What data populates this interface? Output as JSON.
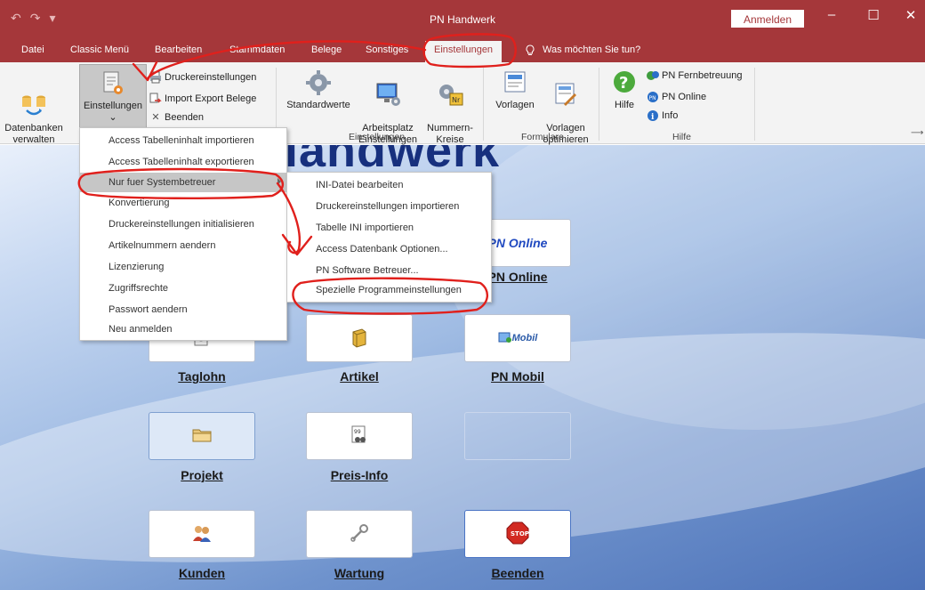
{
  "window": {
    "title": "PN Handwerk",
    "signin_label": "Anmelden",
    "controls": {
      "minimize": "–",
      "maximize": "☐",
      "close": "✕"
    },
    "qat": {
      "undo": "↶",
      "redo": "↷",
      "customize": "▾"
    }
  },
  "tabs": [
    "Datei",
    "Classic Menü",
    "Bearbeiten",
    "Stammdaten",
    "Belege",
    "Sonstiges",
    "Einstellungen"
  ],
  "active_tab": "Einstellungen",
  "tell_me": {
    "icon": "lightbulb-icon",
    "label": "Was möchten Sie tun?"
  },
  "ribbon": {
    "datenbanken": "Datenbanken\nverwalten",
    "einstellungen": "Einstellungen",
    "einstellungen_caret": "⌄",
    "druckereinstellungen": "Druckereinstellungen",
    "import_export": "Import Export Belege",
    "beenden": "Beenden",
    "standardwerte": "Standardwerte",
    "arbeitsplatz": "Arbeitsplatz\nEinstellungen",
    "nummernkreise": "Nummern-\nKreise",
    "vorlagen": "Vorlagen",
    "vorlagen_opt": "Vorlagen\noptimieren",
    "hilfe": "Hilfe",
    "fernbetreuung": "PN Fernbetreuung",
    "pn_online": "PN Online",
    "info": "Info",
    "group_einstellungen": "Einstellungen",
    "group_formulare": "Formulare",
    "group_hilfe": "Hilfe"
  },
  "menu_main": [
    "Access Tabelleninhalt importieren",
    "Access Tabelleninhalt exportieren",
    "Nur fuer Systembetreuer",
    "Konvertierung",
    "Druckereinstellungen initialisieren",
    "Artikelnummern aendern",
    "Lizenzierung",
    "Zugriffsrechte",
    "Passwort aendern",
    "Neu anmelden"
  ],
  "menu_sub": [
    "INI-Datei bearbeiten",
    "Druckereinstellungen importieren",
    "Tabelle INI importieren",
    "Access Datenbank Optionen...",
    "PN Software Betreuer...",
    "Spezielle Programmeinstellungen"
  ],
  "main": {
    "banner": "landwerk",
    "pn_online_tile": "PN Online",
    "pn_mobil_tile": "Mobil",
    "tiles": {
      "pn_online": "PN Online",
      "taglohn": "Taglohn",
      "artikel": "Artikel",
      "pn_mobil": "PN Mobil",
      "projekt": "Projekt",
      "preis_info": "Preis-Info",
      "kunden": "Kunden",
      "wartung": "Wartung",
      "beenden": "Beenden"
    },
    "stop_sign": "STOP"
  },
  "colors": {
    "titlebar": "#a5373a",
    "accent_blue": "#17307e",
    "annotation_red": "#e0201c"
  }
}
